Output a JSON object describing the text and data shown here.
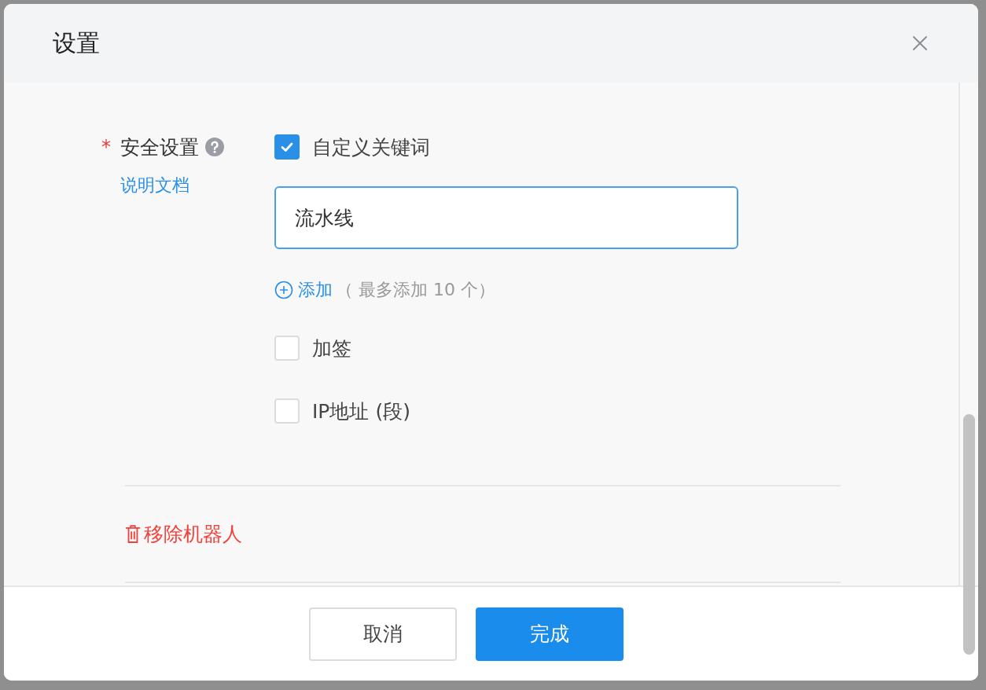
{
  "dialog": {
    "title": "设置"
  },
  "security": {
    "required_mark": "*",
    "label": "安全设置",
    "doc_link": "说明文档",
    "options": [
      {
        "kind": "keyword",
        "label": "自定义关键词",
        "checked": true,
        "keywords": [
          "流水线"
        ],
        "add_link": "添加",
        "add_hint": "（ 最多添加 10 个）"
      },
      {
        "kind": "plain",
        "label": "加签",
        "checked": false
      },
      {
        "kind": "plain",
        "label": "IP地址 (段)",
        "checked": false
      }
    ]
  },
  "remove_link": "移除机器人",
  "buttons": [
    {
      "label": "取消",
      "kind": "secondary"
    },
    {
      "label": "完成",
      "kind": "primary"
    }
  ]
}
